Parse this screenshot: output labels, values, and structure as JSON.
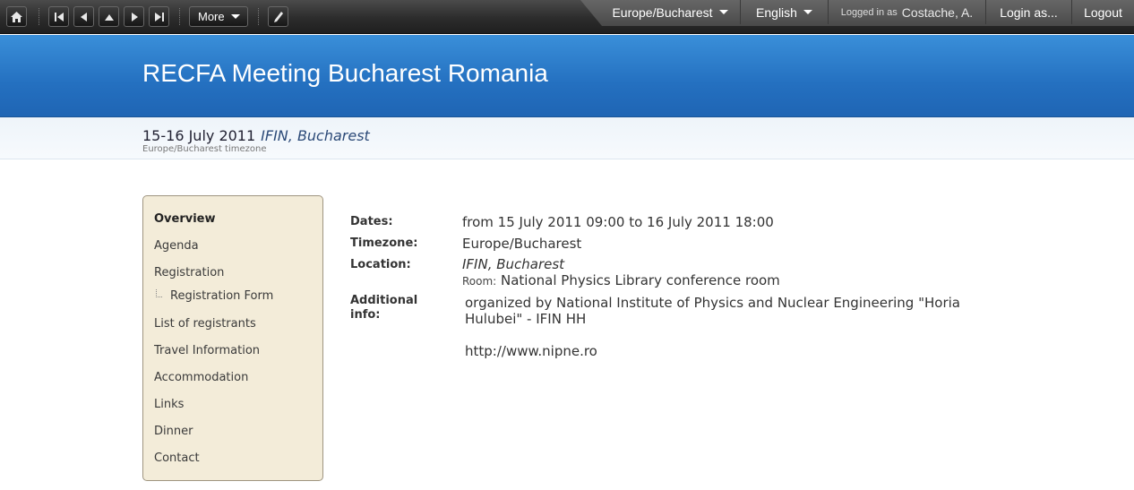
{
  "toolbar": {
    "home_icon": "home-icon",
    "first_icon": "first-page-icon",
    "prev_icon": "previous-icon",
    "up_icon": "up-icon",
    "next_icon": "next-icon",
    "last_icon": "last-page-icon",
    "more_label": "More",
    "edit_icon": "pencil-icon",
    "timezone_label": "Europe/Bucharest",
    "language_label": "English",
    "logged_in_prefix": "Logged in as",
    "logged_in_user": "Costache, A.",
    "login_as_label": "Login as...",
    "logout_label": "Logout"
  },
  "header": {
    "title": "RECFA Meeting Bucharest Romania",
    "date": "15-16 July 2011",
    "place": "IFIN, Bucharest",
    "timezone_note": "Europe/Bucharest timezone"
  },
  "menu": {
    "items": [
      "Overview",
      "Agenda",
      "Registration",
      "Registration Form",
      "List of registrants",
      "Travel Information",
      "Accommodation",
      "Links",
      "Dinner",
      "Contact"
    ]
  },
  "details": {
    "dates_label": "Dates:",
    "dates_value": "from 15 July 2011 09:00 to 16 July 2011 18:00",
    "timezone_label": "Timezone:",
    "timezone_value": "Europe/Bucharest",
    "location_label": "Location:",
    "location_value": "IFIN, Bucharest",
    "room_prefix": "Room:",
    "room_value": "National Physics Library conference room",
    "info_label": "Additional info:",
    "info_text": "organized by National Institute of Physics and Nuclear Engineering \"Horia Hulubei\" - IFIN HH",
    "info_url": "http://www.nipne.ro"
  }
}
